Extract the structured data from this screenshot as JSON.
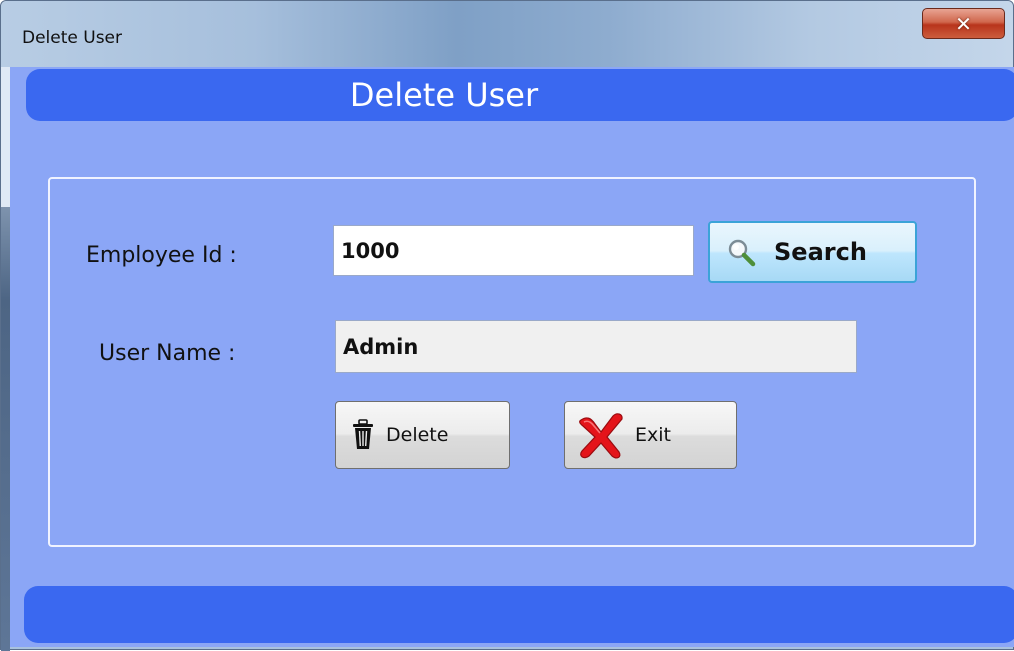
{
  "window": {
    "title": "Delete User",
    "close_icon": "close-icon"
  },
  "header": {
    "title": "Delete User"
  },
  "form": {
    "employee_id_label": "Employee Id :",
    "employee_id_value": "1000",
    "user_name_label": "User Name :",
    "user_name_value": "Admin"
  },
  "buttons": {
    "search_label": "Search",
    "delete_label": "Delete",
    "exit_label": "Exit"
  },
  "icons": {
    "search": "magnifier-icon",
    "delete": "trash-icon",
    "exit": "red-x-icon"
  },
  "colors": {
    "client_background": "#8ba6f6",
    "band": "#3a68f0",
    "close_button": "#c84b2f"
  }
}
